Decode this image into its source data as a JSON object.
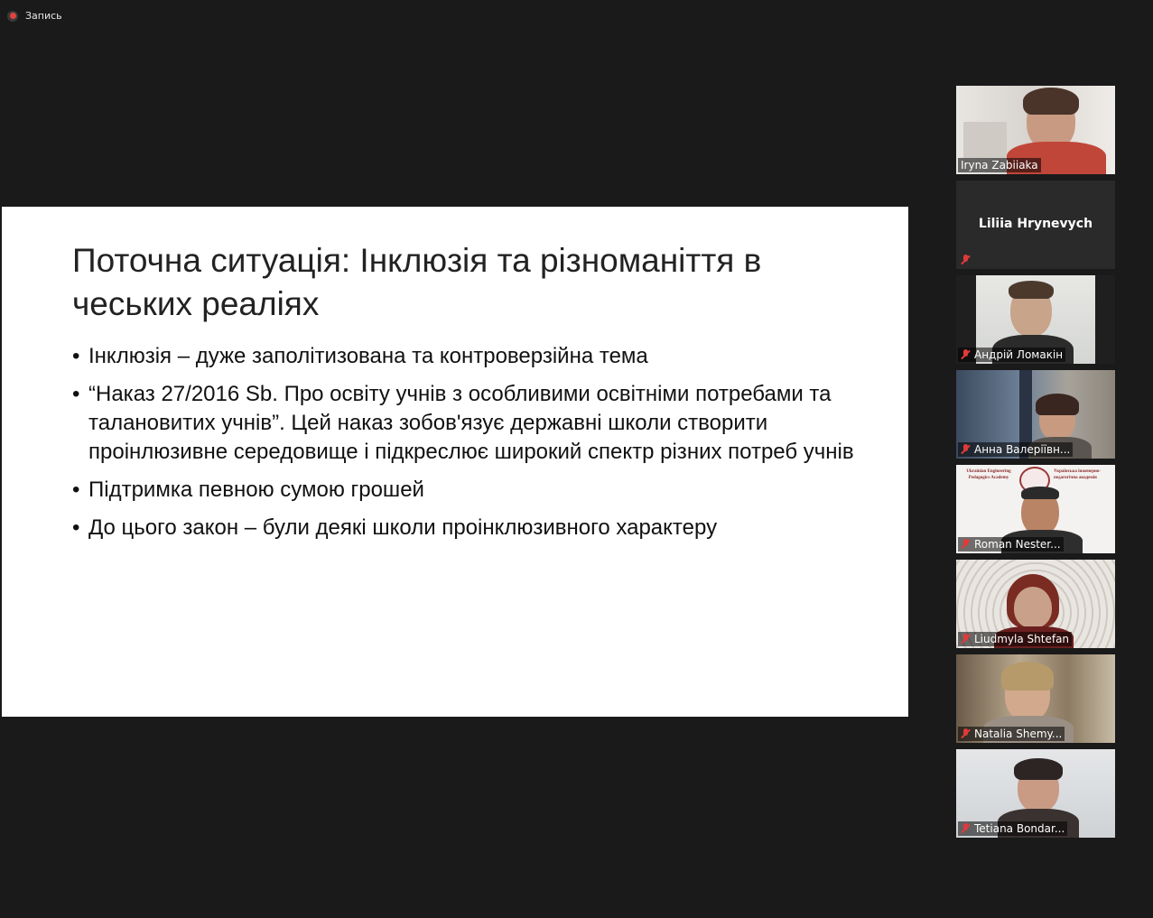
{
  "recording": {
    "label": "Запись"
  },
  "slide": {
    "title": "Поточна ситуація: Інклюзія та різноманіття в чеських реаліях",
    "bullets": [
      "Інклюзія – дуже заполітизована та контроверзійна тема",
      "“Наказ 27/2016 Sb. Про освіту учнів з особливими освітніми потребами та талановитих учнів”. Цей наказ зобов'язує державні школи створити проінлюзивне середовище і підкреслює широкий спектр різних потреб учнів",
      "Підтримка певною сумою грошей",
      "До цього закон – були деякі школи проінклюзивного характеру"
    ]
  },
  "participants": [
    {
      "name": "Iryna Zabiiaka",
      "muted": false,
      "video": true
    },
    {
      "name": "Liliia Hrynevych",
      "muted": true,
      "video": false
    },
    {
      "name": "Андрій Ломакін",
      "muted": true,
      "video": true
    },
    {
      "name": "Анна Валеріївн...",
      "muted": true,
      "video": true
    },
    {
      "name": "Roman Nester...",
      "muted": true,
      "video": true
    },
    {
      "name": "Liudmyla Shtefan",
      "muted": true,
      "video": true
    },
    {
      "name": "Natalia Shemy...",
      "muted": true,
      "video": true
    },
    {
      "name": "Tetiana Bondar...",
      "muted": true,
      "video": true
    }
  ],
  "banner": {
    "left": "Ukrainian Engineering Pedagogics Academy",
    "right": "Українська інженерно-педагогічна академія"
  },
  "colors": {
    "background": "#1a1a1a",
    "muted_icon": "#e03a3a",
    "slide_bg": "#ffffff"
  }
}
